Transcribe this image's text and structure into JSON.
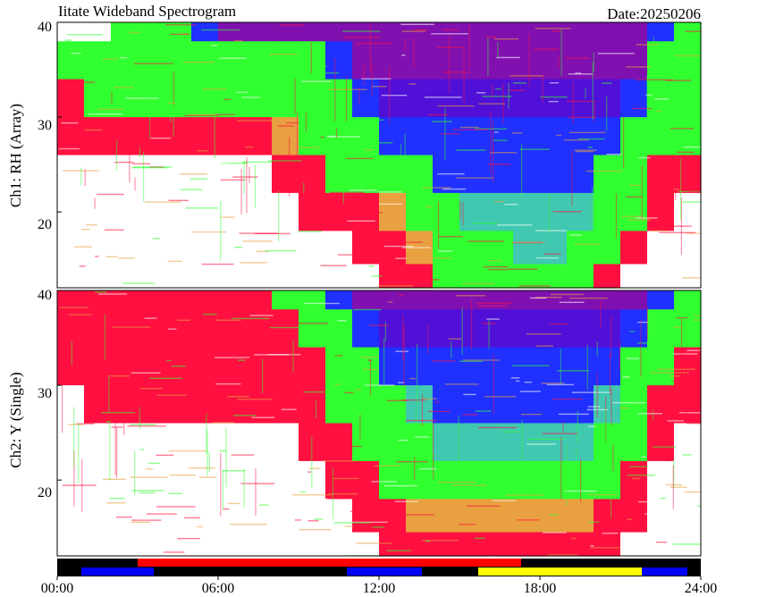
{
  "header": {
    "title": "Iitate Wideband Spectrogram",
    "date": "Date:20250206"
  },
  "panels": [
    {
      "ylabel": "Ch1: RH (Array)",
      "yticks": [
        "40",
        "30",
        "20"
      ]
    },
    {
      "ylabel": "Ch2: Y (Single)",
      "yticks": [
        "40",
        "30",
        "20"
      ]
    }
  ],
  "xticks": [
    "00:00",
    "06:00",
    "12:00",
    "18:00",
    "24:00"
  ],
  "colors": {
    "white": "#ffffff",
    "red": "#ff1040",
    "orange": "#e8a040",
    "green": "#30ff30",
    "cyan": "#40c8b0",
    "blue": "#2030ff",
    "violet": "#5010d8",
    "purple": "#8010b0"
  },
  "chart_data": {
    "type": "heatmap",
    "x_unit": "hours",
    "xlim": [
      0,
      24
    ],
    "ylim": [
      12,
      40
    ],
    "channels": [
      {
        "name": "Ch1: RH (Array)",
        "rows": [
          {
            "y": 40,
            "cells": [
              "white",
              "white",
              "green",
              "green",
              "green",
              "blue",
              "purple",
              "purple",
              "purple",
              "purple",
              "purple",
              "purple",
              "purple",
              "purple",
              "purple",
              "purple",
              "purple",
              "purple",
              "purple",
              "purple",
              "purple",
              "purple",
              "blue",
              "green"
            ]
          },
          {
            "y": 36,
            "cells": [
              "green",
              "green",
              "green",
              "green",
              "green",
              "green",
              "green",
              "green",
              "green",
              "green",
              "blue",
              "purple",
              "purple",
              "purple",
              "purple",
              "purple",
              "purple",
              "purple",
              "purple",
              "purple",
              "purple",
              "purple",
              "green",
              "green"
            ]
          },
          {
            "y": 32,
            "cells": [
              "red",
              "green",
              "green",
              "green",
              "green",
              "green",
              "green",
              "green",
              "green",
              "green",
              "green",
              "blue",
              "violet",
              "violet",
              "violet",
              "violet",
              "violet",
              "violet",
              "violet",
              "violet",
              "violet",
              "blue",
              "green",
              "green"
            ]
          },
          {
            "y": 28,
            "cells": [
              "red",
              "red",
              "red",
              "red",
              "red",
              "red",
              "red",
              "red",
              "orange",
              "green",
              "green",
              "green",
              "blue",
              "blue",
              "blue",
              "blue",
              "blue",
              "blue",
              "blue",
              "blue",
              "blue",
              "green",
              "green",
              "green"
            ]
          },
          {
            "y": 24,
            "cells": [
              "white",
              "white",
              "white",
              "white",
              "white",
              "white",
              "white",
              "white",
              "red",
              "red",
              "green",
              "green",
              "green",
              "green",
              "blue",
              "blue",
              "blue",
              "blue",
              "blue",
              "blue",
              "green",
              "green",
              "red",
              "red"
            ]
          },
          {
            "y": 20,
            "cells": [
              "white",
              "white",
              "white",
              "white",
              "white",
              "white",
              "white",
              "white",
              "white",
              "red",
              "red",
              "red",
              "orange",
              "green",
              "green",
              "cyan",
              "cyan",
              "cyan",
              "cyan",
              "cyan",
              "green",
              "green",
              "red",
              "white"
            ]
          },
          {
            "y": 16,
            "cells": [
              "white",
              "white",
              "white",
              "white",
              "white",
              "white",
              "white",
              "white",
              "white",
              "white",
              "white",
              "red",
              "red",
              "orange",
              "green",
              "green",
              "green",
              "cyan",
              "cyan",
              "green",
              "green",
              "red",
              "white",
              "white"
            ]
          },
          {
            "y": 13,
            "cells": [
              "white",
              "white",
              "white",
              "white",
              "white",
              "white",
              "white",
              "white",
              "white",
              "white",
              "white",
              "white",
              "red",
              "red",
              "green",
              "green",
              "green",
              "green",
              "green",
              "green",
              "red",
              "white",
              "white",
              "white"
            ]
          }
        ]
      },
      {
        "name": "Ch2: Y (Single)",
        "rows": [
          {
            "y": 40,
            "cells": [
              "red",
              "red",
              "red",
              "red",
              "red",
              "red",
              "red",
              "red",
              "green",
              "green",
              "blue",
              "purple",
              "purple",
              "purple",
              "purple",
              "purple",
              "purple",
              "purple",
              "purple",
              "purple",
              "purple",
              "purple",
              "blue",
              "green"
            ]
          },
          {
            "y": 36,
            "cells": [
              "red",
              "red",
              "red",
              "red",
              "red",
              "red",
              "red",
              "red",
              "red",
              "green",
              "green",
              "blue",
              "violet",
              "violet",
              "violet",
              "violet",
              "violet",
              "violet",
              "violet",
              "violet",
              "violet",
              "blue",
              "green",
              "green"
            ]
          },
          {
            "y": 32,
            "cells": [
              "red",
              "red",
              "red",
              "red",
              "red",
              "red",
              "red",
              "red",
              "red",
              "red",
              "green",
              "green",
              "blue",
              "blue",
              "blue",
              "blue",
              "blue",
              "blue",
              "blue",
              "blue",
              "blue",
              "green",
              "green",
              "red"
            ]
          },
          {
            "y": 28,
            "cells": [
              "white",
              "red",
              "red",
              "red",
              "red",
              "red",
              "red",
              "red",
              "red",
              "red",
              "green",
              "green",
              "green",
              "cyan",
              "blue",
              "blue",
              "blue",
              "blue",
              "blue",
              "blue",
              "cyan",
              "green",
              "red",
              "red"
            ]
          },
          {
            "y": 24,
            "cells": [
              "white",
              "white",
              "white",
              "white",
              "white",
              "white",
              "white",
              "white",
              "white",
              "red",
              "red",
              "green",
              "green",
              "green",
              "cyan",
              "cyan",
              "cyan",
              "cyan",
              "cyan",
              "cyan",
              "green",
              "green",
              "red",
              "white"
            ]
          },
          {
            "y": 20,
            "cells": [
              "white",
              "white",
              "white",
              "white",
              "white",
              "white",
              "white",
              "white",
              "white",
              "white",
              "red",
              "red",
              "green",
              "green",
              "green",
              "green",
              "green",
              "green",
              "green",
              "green",
              "green",
              "red",
              "white",
              "white"
            ]
          },
          {
            "y": 16,
            "cells": [
              "white",
              "white",
              "white",
              "white",
              "white",
              "white",
              "white",
              "white",
              "white",
              "white",
              "white",
              "red",
              "red",
              "orange",
              "orange",
              "orange",
              "orange",
              "orange",
              "orange",
              "orange",
              "red",
              "red",
              "white",
              "white"
            ]
          },
          {
            "y": 13,
            "cells": [
              "white",
              "white",
              "white",
              "white",
              "white",
              "white",
              "white",
              "white",
              "white",
              "white",
              "white",
              "white",
              "red",
              "red",
              "red",
              "red",
              "red",
              "red",
              "red",
              "red",
              "red",
              "white",
              "white",
              "white"
            ]
          }
        ]
      }
    ],
    "status_bar": {
      "upper": [
        {
          "from": 0,
          "to": 3,
          "color": "#000000"
        },
        {
          "from": 3,
          "to": 17.3,
          "color": "#ff0000"
        },
        {
          "from": 17.3,
          "to": 24,
          "color": "#000000"
        }
      ],
      "lower": [
        {
          "from": 0,
          "to": 0.9,
          "color": "#000000"
        },
        {
          "from": 0.9,
          "to": 3.6,
          "color": "#0000ff"
        },
        {
          "from": 3.6,
          "to": 10.8,
          "color": "#000000"
        },
        {
          "from": 10.8,
          "to": 13.6,
          "color": "#0000ff"
        },
        {
          "from": 13.6,
          "to": 15.7,
          "color": "#000000"
        },
        {
          "from": 15.7,
          "to": 21.8,
          "color": "#ffff00"
        },
        {
          "from": 21.8,
          "to": 23.5,
          "color": "#0000ff"
        },
        {
          "from": 23.5,
          "to": 24,
          "color": "#000000"
        }
      ]
    }
  }
}
